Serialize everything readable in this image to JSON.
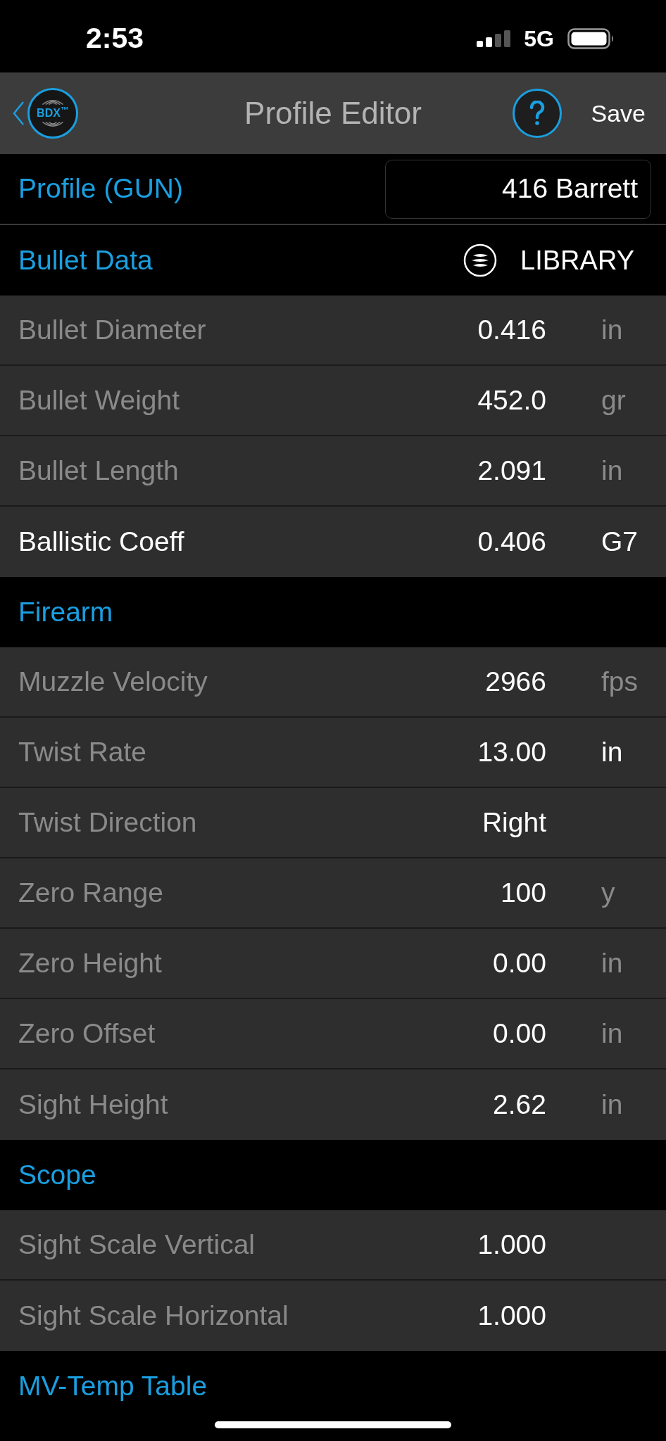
{
  "status_bar": {
    "time": "2:53",
    "network": "5G"
  },
  "nav_bar": {
    "logo_text": "BDX$^{™}$",
    "title": "Profile Editor",
    "save": "Save"
  },
  "profile": {
    "label": "Profile (GUN)",
    "value": "416 Barrett"
  },
  "sections": [
    {
      "title": "Bullet Data",
      "action": "LIBRARY",
      "rows": [
        {
          "label": "Bullet Diameter",
          "value": "0.416",
          "unit": "in",
          "label_dimmed": true,
          "unit_dimmed": true
        },
        {
          "label": "Bullet Weight",
          "value": "452.0",
          "unit": "gr",
          "label_dimmed": true,
          "unit_dimmed": true
        },
        {
          "label": "Bullet Length",
          "value": "2.091",
          "unit": "in",
          "label_dimmed": true,
          "unit_dimmed": true
        },
        {
          "label": "Ballistic Coeff",
          "value": "0.406",
          "unit": "G7",
          "label_dimmed": false,
          "unit_dimmed": false
        }
      ]
    },
    {
      "title": "Firearm",
      "rows": [
        {
          "label": "Muzzle Velocity",
          "value": "2966",
          "unit": "fps",
          "label_dimmed": true,
          "unit_dimmed": true
        },
        {
          "label": "Twist Rate",
          "value": "13.00",
          "unit": "in",
          "label_dimmed": true,
          "unit_dimmed": false
        },
        {
          "label": "Twist Direction",
          "value": "Right",
          "label_dimmed": true
        },
        {
          "label": "Zero Range",
          "value": "100",
          "unit": "y",
          "label_dimmed": true,
          "unit_dimmed": true
        },
        {
          "label": "Zero Height",
          "value": "0.00",
          "unit": "in",
          "label_dimmed": true,
          "unit_dimmed": true
        },
        {
          "label": "Zero Offset",
          "value": "0.00",
          "unit": "in",
          "label_dimmed": true,
          "unit_dimmed": true
        },
        {
          "label": "Sight Height",
          "value": "2.62",
          "unit": "in",
          "label_dimmed": true,
          "unit_dimmed": true
        }
      ]
    },
    {
      "title": "Scope",
      "rows": [
        {
          "label": "Sight Scale Vertical",
          "value": "1.000",
          "label_dimmed": true
        },
        {
          "label": "Sight Scale Horizontal",
          "value": "1.000",
          "label_dimmed": true
        }
      ]
    },
    {
      "title": "MV-Temp Table"
    }
  ]
}
